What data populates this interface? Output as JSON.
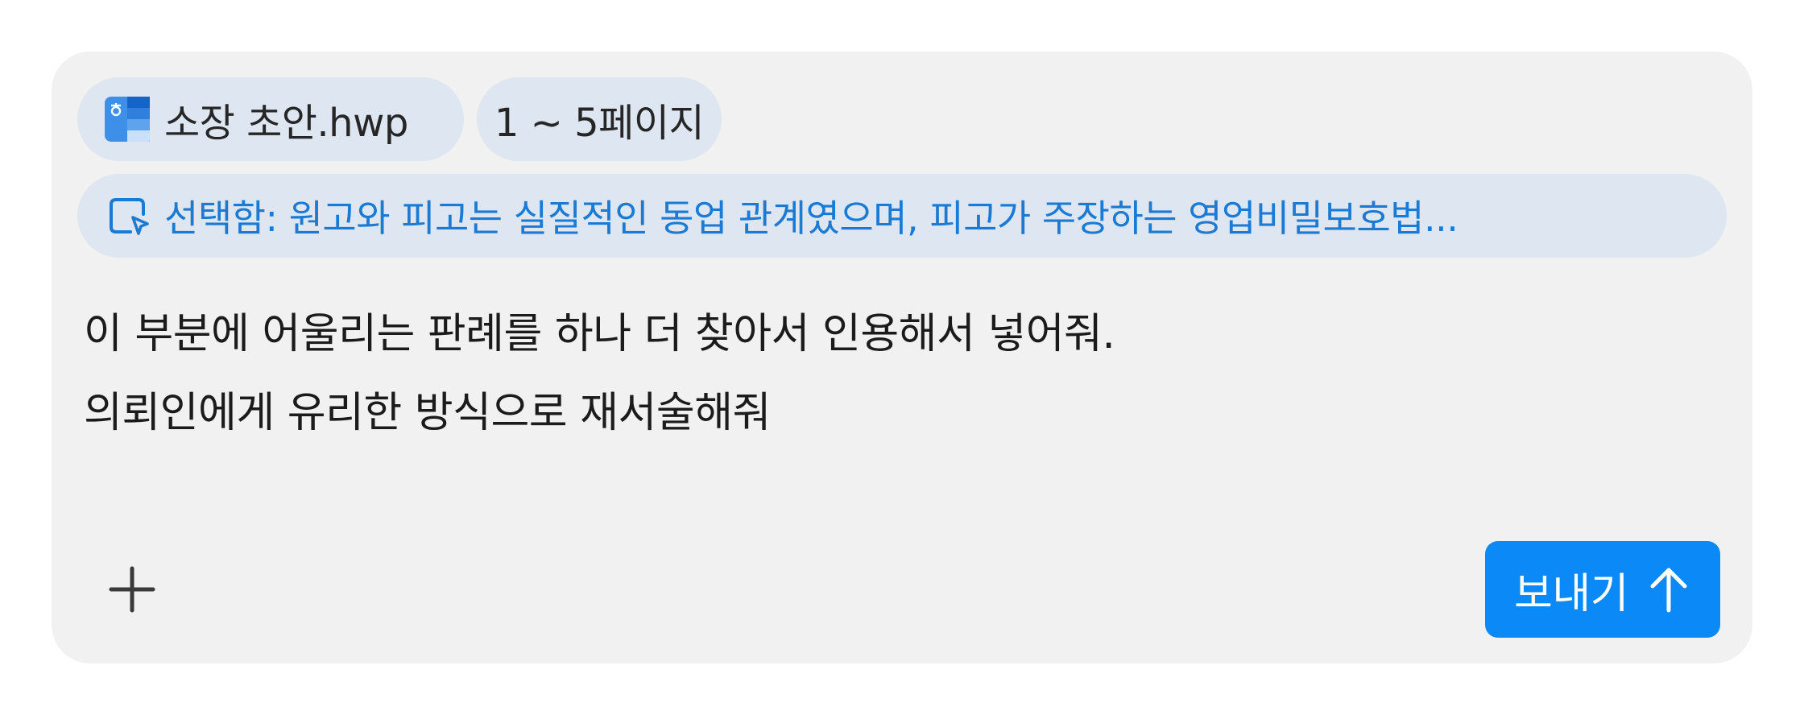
{
  "attachments": {
    "file": {
      "name": "소장 초안.hwp",
      "icon": "hwp-document-icon"
    },
    "page_range": "1 ~ 5페이지"
  },
  "selection": {
    "icon": "selection-cursor-icon",
    "text": "선택함: 원고와 피고는 실질적인 동업 관계였으며, 피고가 주장하는 영업비밀보호법..."
  },
  "message": {
    "lines": [
      "이 부분에 어울리는 판례를 하나 더 찾아서 인용해서 넣어줘.",
      "의뢰인에게 유리한 방식으로 재서술해줘"
    ]
  },
  "toolbar": {
    "add_icon": "plus-icon",
    "send_label": "보내기",
    "send_icon": "arrow-up-icon"
  },
  "colors": {
    "accent": "#0a89f7",
    "selection_text": "#1a7ad4",
    "chip_background": "#dde6f1",
    "composer_background": "#f1f1f1"
  }
}
